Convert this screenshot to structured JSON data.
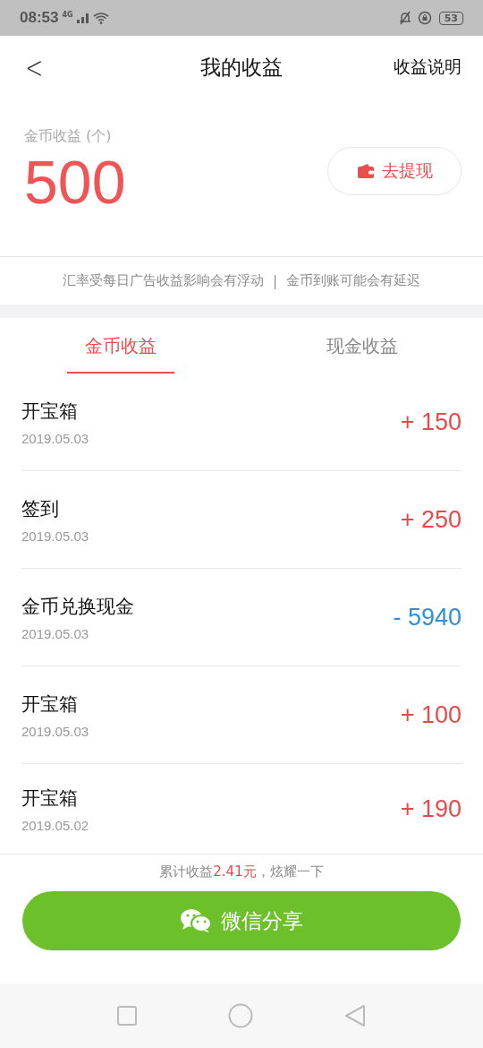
{
  "status_bar": {
    "time": "08:53",
    "network": "4G",
    "battery": "53"
  },
  "header": {
    "back": "<",
    "title": "我的收益",
    "action": "收益说明"
  },
  "summary": {
    "label": "金币收益 (个)",
    "amount": "500",
    "withdraw_button": "去提现"
  },
  "notice": {
    "left": "汇率受每日广告收益影响会有浮动",
    "separator": "|",
    "right": "金币到账可能会有延迟"
  },
  "tabs": [
    {
      "label": "金币收益",
      "selected": true
    },
    {
      "label": "现金收益",
      "selected": false
    }
  ],
  "records": [
    {
      "title": "开宝箱",
      "date": "2019.05.03",
      "amount": "+ 150",
      "kind": "income"
    },
    {
      "title": "签到",
      "date": "2019.05.03",
      "amount": "+ 250",
      "kind": "income"
    },
    {
      "title": "金币兑换现金",
      "date": "2019.05.03",
      "amount": "- 5940",
      "kind": "expense"
    },
    {
      "title": "开宝箱",
      "date": "2019.05.03",
      "amount": "+ 100",
      "kind": "income"
    },
    {
      "title": "开宝箱",
      "date": "2019.05.02",
      "amount": "+ 190",
      "kind": "income"
    }
  ],
  "footer": {
    "total_text": "累计收益**2.41元**，炫耀一下",
    "share_button": "微信分享"
  }
}
